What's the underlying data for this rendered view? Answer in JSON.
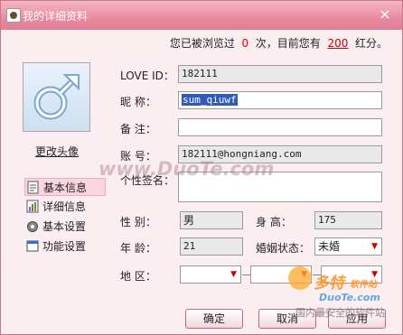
{
  "window": {
    "title": "我的详细资料",
    "close_glyph": "×"
  },
  "info": {
    "prefix": "您已被浏览过",
    "views": "0",
    "mid": "次，目前您有",
    "red": "200",
    "suffix": "红分。"
  },
  "avatar": {
    "change_label": "更改头像",
    "icon": "male-symbol-icon"
  },
  "nav": [
    {
      "label": "基本信息",
      "icon": "document-icon"
    },
    {
      "label": "详细信息",
      "icon": "chart-icon"
    },
    {
      "label": "基本设置",
      "icon": "gear-icon"
    },
    {
      "label": "功能设置",
      "icon": "window-icon"
    }
  ],
  "form": {
    "love_id_label": "LOVE  ID：",
    "love_id": "182111",
    "nickname_label": "昵    称：",
    "nickname": "sum_qiuwf",
    "note_label": "备    注：",
    "note": "",
    "account_label": "账    号：",
    "account": "182111@hongniang.com",
    "signature_label": "个性签名：",
    "signature": "",
    "gender_label": "性    别：",
    "gender": "男",
    "height_label": "身    高：",
    "height": "175",
    "age_label": "年    龄：",
    "age": "21",
    "marital_label": "婚姻状态：",
    "marital": "未婚",
    "region_label": "地    区："
  },
  "buttons": {
    "ok": "确定",
    "cancel": "取消",
    "apply": "应用"
  },
  "watermarks": {
    "center": "www.DuoTe.com",
    "logo": "多特",
    "logo_sub": "软件站",
    "url": "DuoTe.com",
    "tagline": "国内最安全的软件站"
  }
}
